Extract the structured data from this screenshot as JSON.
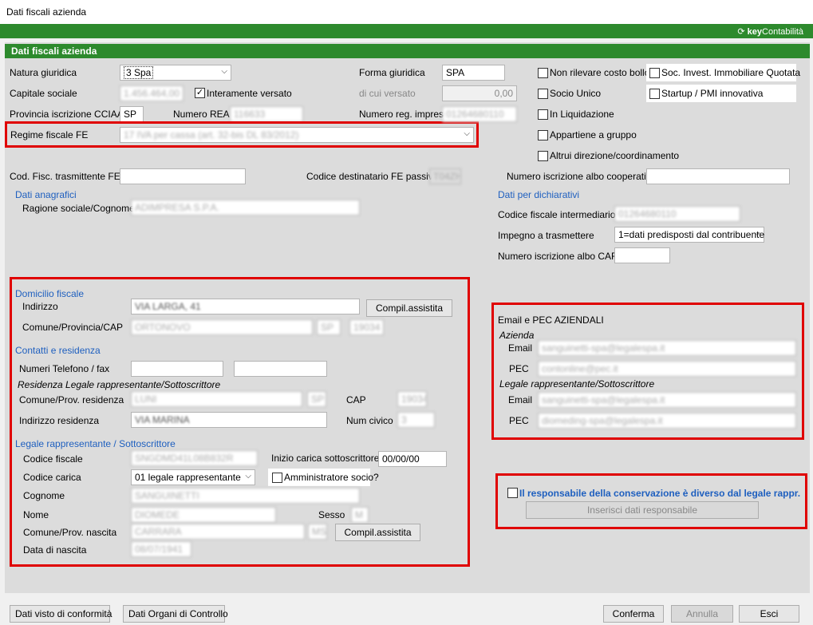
{
  "window": {
    "title": "Dati fiscali azienda"
  },
  "brand": {
    "prefix": "key",
    "name": "Contabilità"
  },
  "section": {
    "title": "Dati fiscali azienda"
  },
  "left": {
    "natura_label": "Natura giuridica",
    "natura_value": "3 Spa",
    "capitale_label": "Capitale sociale",
    "capitale_value": "1.456.464,00",
    "interamente_label": "Interamente versato",
    "provincia_label": "Provincia iscrizione CCIAA",
    "provincia_value": "SP",
    "rea_label": "Numero REA",
    "rea_value": "116633",
    "regime_label": "Regime fiscale FE",
    "regime_value": "17 IVA per cassa (art. 32-bis DL 83/2012)",
    "forma_label": "Forma giuridica",
    "forma_value": "SPA",
    "dicui_label": "di cui versato",
    "dicui_value": "0,00",
    "numreg_label": "Numero reg. imprese",
    "numreg_value": "01264680110"
  },
  "checks": {
    "non_rilevare": "Non rilevare costo bollo",
    "soc_invest": "Soc. Invest. Immobiliare Quotata",
    "socio_unico": "Socio Unico",
    "startup": "Startup / PMI innovativa",
    "liquidazione": "In Liquidazione",
    "gruppo": "Appartiene a gruppo",
    "altrui": "Altrui direzione/coordinamento"
  },
  "row2": {
    "cod_fisc_label": "Cod. Fisc. trasmittente FE",
    "dest_label": "Codice destinatario FE passive",
    "dest_value": "T04ZHR3",
    "albo_coop_label": "Numero iscrizione albo cooperative"
  },
  "anagrafici": {
    "title": "Dati anagrafici",
    "ragione_label": "Ragione sociale/Cognome",
    "ragione_value": "ADIMPRESA S.P.A."
  },
  "dichiarativi": {
    "title": "Dati per dichiarativi",
    "cf_int_label": "Codice fiscale intermediario",
    "cf_int_value": "01264680110",
    "impegno_label": "Impegno a trasmettere",
    "impegno_value": "1=dati predisposti dal contribuente",
    "albo_caf_label": "Numero iscrizione albo CAF"
  },
  "domicilio": {
    "title": "Domicilio fiscale",
    "indirizzo_label": "Indirizzo",
    "indirizzo_value": "VIA LARGA, 41",
    "compil_label": "Compil.assistita",
    "comune_label": "Comune/Provincia/CAP",
    "comune_value": "ORTONOVO",
    "prov_value": "SP",
    "cap_value": "19034"
  },
  "contatti": {
    "title": "Contatti e residenza",
    "tel_label": "Numeri Telefono / fax",
    "residenza_title": "Residenza Legale rappresentante/Sottoscrittore",
    "comune_res_label": "Comune/Prov. residenza",
    "comune_res_value": "LUNI",
    "prov_res_value": "SP",
    "cap_label": "CAP",
    "cap_value": "19034",
    "ind_res_label": "Indirizzo residenza",
    "ind_res_value": "VIA MARINA",
    "civico_label": "Num civico",
    "civico_value": "3"
  },
  "legale": {
    "title": "Legale rappresentante / Sottoscrittore",
    "cf_label": "Codice fiscale",
    "cf_value": "SNGDMD41L08B832R",
    "inizio_label": "Inizio carica sottoscrittore",
    "inizio_value": "00/00/00",
    "carica_label": "Codice carica",
    "carica_value": "01 legale rappresentante",
    "ammin_label": "Amministratore socio?",
    "cognome_label": "Cognome",
    "cognome_value": "SANGUINETTI",
    "nome_label": "Nome",
    "nome_value": "DIOMEDE",
    "sesso_label": "Sesso",
    "sesso_value": "M",
    "nascita_label": "Comune/Prov. nascita",
    "nascita_value": "CARRARA",
    "nascita_prov": "MS",
    "compil_label": "Compil.assistita",
    "data_label": "Data di nascita",
    "data_value": "08/07/1941"
  },
  "email": {
    "title": "Email e PEC AZIENDALI",
    "azienda_title": "Azienda",
    "email_label": "Email",
    "email_value": "sanguinetti-spa@legalespa.it",
    "pec_label": "PEC",
    "pec_value": "contonline@pec.it",
    "legale_title": "Legale rappresentante/Sottoscrittore",
    "email2_value": "sanguinetti-spa@legalespa.it",
    "pec2_value": "diomeding-spa@legalespa.it"
  },
  "responsabile": {
    "check_label": "Il responsabile della conservazione è diverso dal legale rappr.",
    "button_label": "Inserisci dati responsabile"
  },
  "footer": {
    "visto": "Dati visto di conformità",
    "organi": "Dati Organi di Controllo",
    "conferma": "Conferma",
    "annulla": "Annulla",
    "esci": "Esci"
  }
}
